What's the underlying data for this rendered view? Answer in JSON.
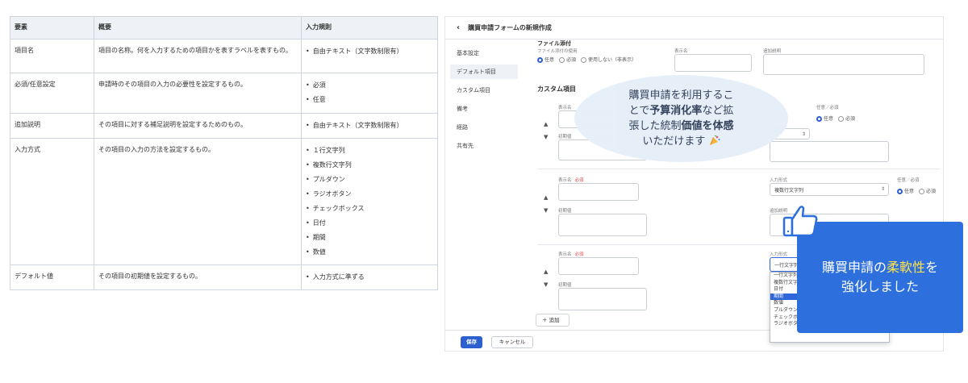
{
  "table": {
    "headers": [
      "要素",
      "概要",
      "入力規則"
    ],
    "rows": [
      {
        "item": "項目名",
        "desc": "項目の名称。何を入力するための項目かを表すラベルを表すもの。",
        "rules": [
          "自由テキスト（文字数制限有）"
        ]
      },
      {
        "item": "必須/任意設定",
        "desc": "申請時のその項目の入力の必要性を設定するもの。",
        "rules": [
          "必須",
          "任意"
        ]
      },
      {
        "item": "追加説明",
        "desc": "その項目に対する補足説明を設定するためのもの。",
        "rules": [
          "自由テキスト（文字数制限有）"
        ]
      },
      {
        "item": "入力方式",
        "desc": "その項目の入力の方法を設定するもの。",
        "rules": [
          "１行文字列",
          "複数行文字列",
          "プルダウン",
          "ラジオボタン",
          "チェックボックス",
          "日付",
          "期間",
          "数値"
        ]
      },
      {
        "item": "デフォルト値",
        "desc": "その項目の初期値を設定するもの。",
        "rules": [
          "入力方式に準ずる"
        ]
      }
    ]
  },
  "app": {
    "title": "購買申請フォームの新規作成",
    "sidebar": [
      "基本設定",
      "デフォルト項目",
      "カスタム項目",
      "備考",
      "経路",
      "共有先"
    ],
    "file_section": {
      "heading": "ファイル添付",
      "usage_label": "ファイル添付の使用",
      "options": [
        "任意",
        "必須",
        "使用しない（非表示）"
      ],
      "display_label": "表示名",
      "extra_label": "追加説明"
    },
    "custom_title": "カスタム項目",
    "field_labels": {
      "display": "表示名",
      "required_tag": "必須",
      "input_type": "入力形式",
      "opt_req": "任意／必須",
      "initial": "初期値",
      "extra": "追加説明",
      "opt_any": "任意",
      "opt_must": "必須"
    },
    "row2_select": "複数行文字列",
    "row3_select": "一行文字列",
    "dropdown_options": [
      "一行文字列",
      "複数行文字列",
      "日付",
      "期間",
      "数値",
      "プルダウン",
      "チェックボックス",
      "ラジオボタン"
    ],
    "dropdown_selected": "期間",
    "add_button": "追加",
    "save_button": "保存",
    "cancel_button": "キャンセル"
  },
  "bubble": {
    "line1": "購買申請を利用するこ",
    "line2a": "とで",
    "line2b": "予算消化率",
    "line2c": "など拡",
    "line3a": "張した統制",
    "line3b": "価値を体感",
    "line4": "いただけます"
  },
  "banner": {
    "line1a": "購買申請の",
    "line1b": "柔軟性",
    "line1c": "を",
    "line2": "強化しました"
  },
  "colors": {
    "primary": "#2d5fcf",
    "banner_bg": "#2c6fdd",
    "banner_highlight": "#ffe14a",
    "required": "#e0484c",
    "bubble_bg": "#e6eef8"
  }
}
